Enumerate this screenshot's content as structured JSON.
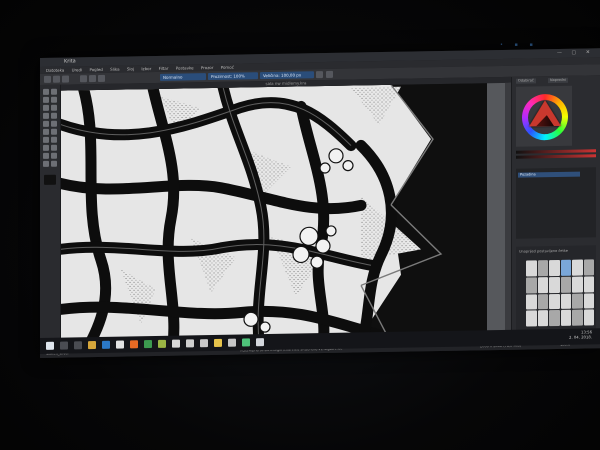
{
  "window": {
    "title": "Krita",
    "doc_title": "sala nw midlemy.kra",
    "controls": "— ▢ ✕"
  },
  "menu": [
    "Datoteka",
    "Uredi",
    "Pogled",
    "Slika",
    "Sloj",
    "Izbor",
    "Filtar",
    "Postavke",
    "Prozor",
    "Pomoć"
  ],
  "toolbar": {
    "blend_mode": "Normalno",
    "opacity_label": "Prozirnost: 100%",
    "size_label": "Veličina: 100,00 px"
  },
  "dock": {
    "tab_a": "Odabirač",
    "tab_b": "Napredni",
    "layer_name": "Pozadina",
    "brushes_title": "Unaprijed postavljene četke"
  },
  "status": {
    "left": "Sketch_silver",
    "center": "RGB/Alpha (8-bit integer/channel)  sRGB-elle-V2-srgbtrc.icc",
    "right": "2000 x 2000 (78,0 MiB)",
    "zoom": "100%"
  },
  "taskbar": {
    "time": "13:56",
    "date": "2. 04. 2018."
  },
  "colors": {
    "accent": "#2a4d7a",
    "canvas_paper": "#e6e6e6",
    "canvas_ink": "#0e0e0e"
  }
}
